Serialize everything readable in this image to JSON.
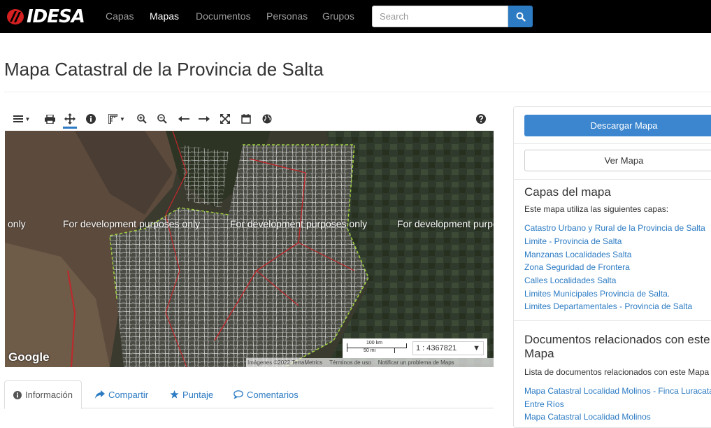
{
  "nav": {
    "brand": "IDESA",
    "links": [
      "Capas",
      "Mapas",
      "Documentos",
      "Personas",
      "Grupos"
    ],
    "active_link": "Mapas",
    "search_placeholder": "Search"
  },
  "page": {
    "title": "Mapa Catastral de la Provincia de Salta"
  },
  "map": {
    "watermark": "For development purposes only",
    "watermark_left": "only",
    "watermark_right": "For development purpos",
    "google": "Google",
    "attribution": [
      "Imágenes ©2022 TerraMetrics",
      "Términos de uso",
      "Notificar un problema de Maps"
    ],
    "scale_km": "100 km",
    "scale_mi": "50 mi",
    "scale_ratio": "1 : 4367821"
  },
  "tabs": [
    {
      "label": "Información",
      "icon": "info-icon",
      "active": true
    },
    {
      "label": "Compartir",
      "icon": "share-icon"
    },
    {
      "label": "Puntaje",
      "icon": "star-icon"
    },
    {
      "label": "Comentarios",
      "icon": "comment-icon"
    }
  ],
  "panel": {
    "download_label": "Descargar Mapa",
    "view_label": "Ver Mapa",
    "layers_title": "Capas del mapa",
    "layers_intro": "Este mapa utiliza las siguientes capas:",
    "layers": [
      "Catastro Urbano y Rural de la Provincia de Salta",
      "Limite - Provincia de Salta",
      "Manzanas Localidades Salta",
      "Zona Seguridad de Frontera",
      "Calles Localidades Salta",
      "Limites Municipales Provincia de Salta.",
      "Limites Departamentales - Provincia de Salta"
    ],
    "docs_title": "Documentos relacionados con este Mapa",
    "docs_intro": "Lista de documentos relacionados con este Mapa",
    "docs": [
      "Mapa Catastral Localidad Molinos - Finca Luracatao",
      "Entre Ríos",
      "Mapa Catastral Localidad Molinos"
    ]
  },
  "colors": {
    "primary": "#3b86cf",
    "link": "#2c7bc3",
    "navbar": "#000000"
  }
}
